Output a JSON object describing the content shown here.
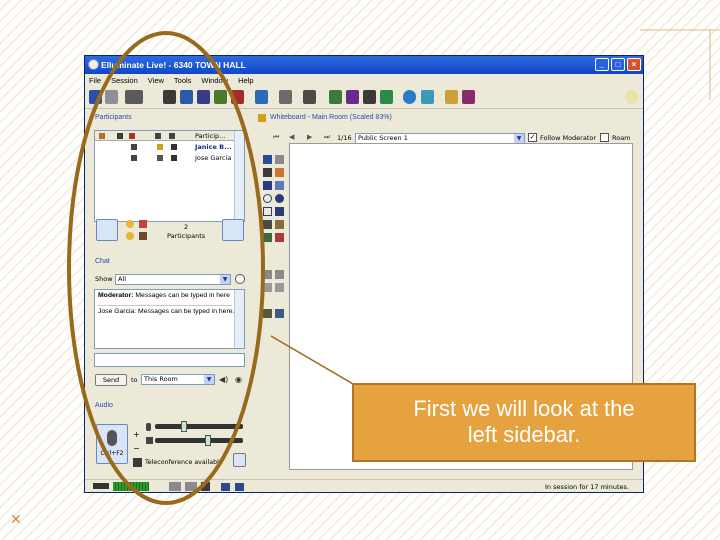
{
  "window": {
    "title": "Elluminate Live! - 6340 TOWN HALL",
    "minimize": "_",
    "maximize": "□",
    "close": "×"
  },
  "menu": [
    "File",
    "Session",
    "View",
    "Tools",
    "Window",
    "Help"
  ],
  "toolbar_icons": [
    "save-icon",
    "print-icon",
    "layout-icon",
    "list-icon",
    "align-icon",
    "filter-icon",
    "check-icon",
    "screen-icon",
    "display-icon",
    "whiteboard-icon",
    "film-icon",
    "video-icon",
    "camera-icon",
    "globe-icon",
    "sync-icon",
    "edit-icon",
    "user-add-icon",
    "help-icon"
  ],
  "participants": {
    "title": "Participants",
    "column_header": "Particip...",
    "rows": [
      {
        "name": "Janice B...",
        "bold": true
      },
      {
        "name": "Jose Garcia",
        "bold": false
      }
    ],
    "count_number": "2",
    "count_label": "Participants"
  },
  "chat": {
    "title": "Chat",
    "show_label": "Show",
    "show_value": "All",
    "messages": [
      {
        "sender": "Moderator:",
        "text": " Messages can be typed in here",
        "bold_sender": true
      },
      {
        "sender": "Jose Garcia:",
        "text": " Messages can be typed in here.",
        "bold_sender": false
      }
    ],
    "input_value": "",
    "send_label": "Send",
    "to_label": "to",
    "to_value": "This Room"
  },
  "audio": {
    "title": "Audio",
    "talk_key": "Ctrl+F2",
    "teleconference": "Teleconference available"
  },
  "whiteboard": {
    "title": "Whiteboard - Main Room (Scaled 83%)",
    "page": "1/16",
    "screen_value": "Public Screen 1",
    "follow_moderator": "Follow Moderator",
    "follow_checked": true,
    "roam": "Roam",
    "roam_checked": false
  },
  "status": {
    "session_text": "In session for 17 minutes."
  },
  "callout": {
    "line1": "First we will look at the",
    "line2": "left sidebar."
  },
  "colors": {
    "accent_orange": "#e6a23f",
    "ellipse": "#9a6a1c",
    "title_blue": "#0f48c8"
  }
}
